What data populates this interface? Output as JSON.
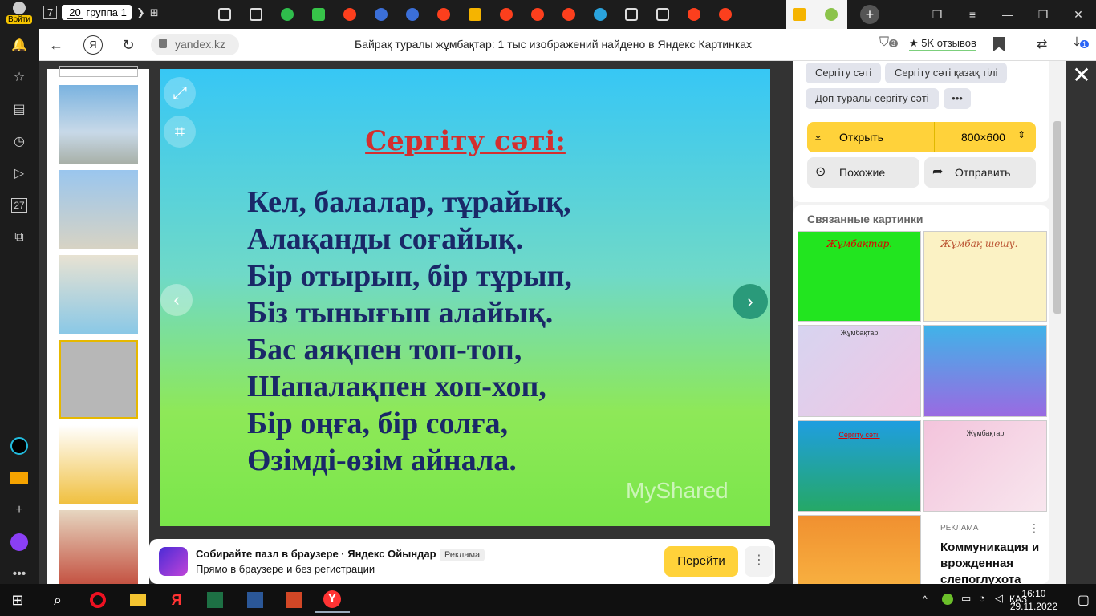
{
  "tabbar": {
    "login_label": "Войти",
    "group_count": "7",
    "group_tab_count": "20",
    "group_name": "группа 1",
    "new_tab_icon": "plus-icon"
  },
  "address_bar": {
    "url": "yandex.kz",
    "page_title": "Байрақ туралы жұмбақтар: 1 тыс изображений найдено в Яндекс Картинках",
    "reviews_label": "5K отзывов",
    "alerts_count": "3",
    "downloads_count": "1"
  },
  "sidebar": {
    "calendar_day": "27"
  },
  "viewer": {
    "title": "Сергіту сәті:",
    "lines": [
      "Кел, балалар, тұрайық,",
      "Алақанды соғайық.",
      "Бір отырып, бір тұрып,",
      "Біз тынығып алайық.",
      "Бас аяқпен топ-топ,",
      "Шапалақпен хоп-хоп,",
      "Бір оңға, бір солға,",
      "Өзімді-өзім айнала."
    ],
    "watermark": "MyShared"
  },
  "ad": {
    "title": "Собирайте пазл в браузере · Яндекс Ойындар",
    "subtitle": "Прямо в браузере и без регистрации",
    "tag": "Реклама",
    "button": "Перейти"
  },
  "panel": {
    "chips": [
      "Сергіту сәті",
      "Сергіту сәті қазақ тілі",
      "Доп туралы сергіту сәті"
    ],
    "open_label": "Открыть",
    "size_label": "800×600",
    "similar_label": "Похожие",
    "share_label": "Отправить",
    "related_title": "Связанные картинки",
    "related_captions": [
      "Жұмбақтар.",
      "Жұмбақ шешу.",
      "Жұмбақтар",
      "Сергіту сәті:",
      "Жұмбақтар"
    ],
    "ad_tag": "РЕКЛАМА",
    "ad_title": "Коммуникация и врожденная слепоглухота"
  },
  "taskbar": {
    "lang": "ҚАЗ",
    "time": "16:10",
    "date": "29.11.2022"
  }
}
